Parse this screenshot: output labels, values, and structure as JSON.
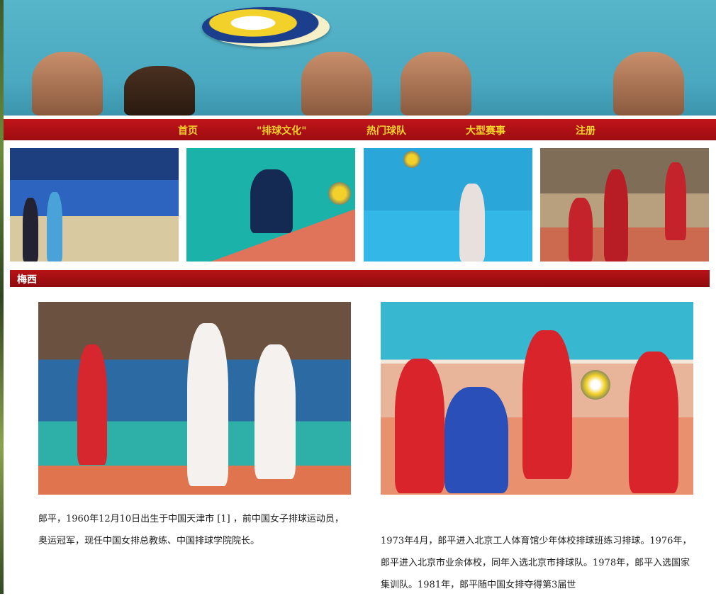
{
  "nav": {
    "items": [
      "首页",
      "\"排球文化\"",
      "热门球队",
      "大型赛事",
      "注册"
    ]
  },
  "section": {
    "title": "梅西"
  },
  "article": {
    "para1": "郎平，1960年12月10日出生于中国天津市 [1] ，前中国女子排球运动员，奥运冠军，现任中国女排总教练、中国排球学院院长。",
    "para2": "1973年4月，郎平进入北京工人体育馆少年体校排球班练习排球。1976年，郎平进入北京市业余体校，同年入选北京市排球队。1978年，郎平入选国家集训队。1981年，郎平随中国女排夺得第3届世"
  },
  "colors": {
    "nav_bg": "#b01015",
    "nav_text": "#f5d12a",
    "section_bg": "#a50e12"
  }
}
